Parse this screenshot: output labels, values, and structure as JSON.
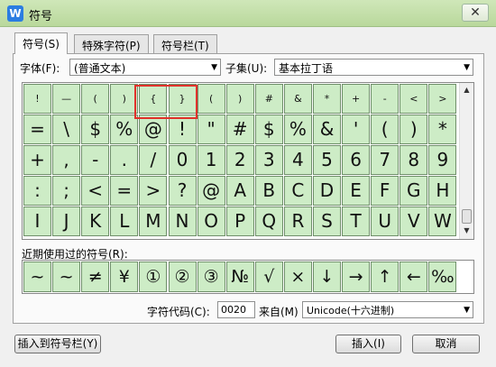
{
  "window": {
    "app_icon_letter": "W",
    "title": "符号",
    "close": "✕"
  },
  "tabs": [
    {
      "label": "符号(S)"
    },
    {
      "label": "特殊字符(P)"
    },
    {
      "label": "符号栏(T)"
    }
  ],
  "font": {
    "label": "字体(F):",
    "value": "(普通文本)"
  },
  "subset": {
    "label": "子集(U):",
    "value": "基本拉丁语"
  },
  "symbols": [
    "!",
    "—",
    "(",
    ")",
    "{",
    "}",
    "(",
    ")",
    "#",
    "&",
    "*",
    "+",
    "-",
    "<",
    ">",
    "=",
    "\\",
    "$",
    "%",
    "@",
    "!",
    "\"",
    "#",
    "$",
    "%",
    "&",
    "'",
    "(",
    ")",
    "*",
    "+",
    ",",
    "-",
    ".",
    "/",
    "0",
    "1",
    "2",
    "3",
    "4",
    "5",
    "6",
    "7",
    "8",
    "9",
    ":",
    ";",
    "<",
    "=",
    ">",
    "?",
    "@",
    "A",
    "B",
    "C",
    "D",
    "E",
    "F",
    "G",
    "H",
    "I",
    "J",
    "K",
    "L",
    "M",
    "N",
    "O",
    "P",
    "Q",
    "R",
    "S",
    "T",
    "U",
    "V",
    "W"
  ],
  "recent": {
    "label": "近期使用过的符号(R):",
    "items": [
      "~",
      "~",
      "≠",
      "¥",
      "①",
      "②",
      "③",
      "№",
      "√",
      "×",
      "↓",
      "→",
      "↑",
      "←",
      "‰"
    ]
  },
  "char_code": {
    "label": "字符代码(C):",
    "value": "0020"
  },
  "from": {
    "label": "来自(M)",
    "value": "Unicode(十六进制)"
  },
  "buttons": {
    "insert_to_bar": "插入到符号栏(Y)",
    "insert": "插入(I)",
    "cancel": "取消"
  }
}
